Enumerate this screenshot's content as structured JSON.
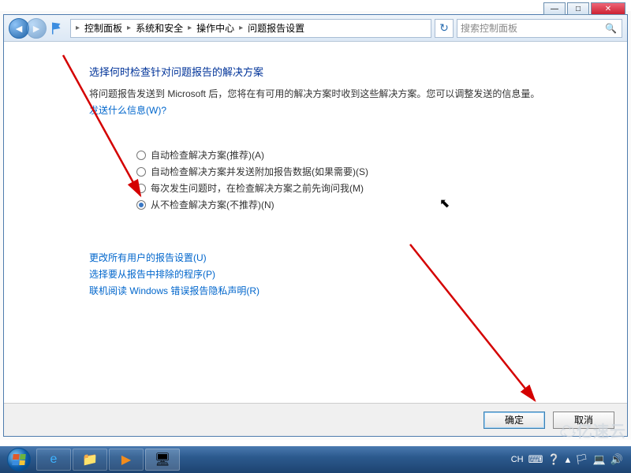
{
  "window_controls": {
    "min": "—",
    "max": "□",
    "close": "✕"
  },
  "breadcrumb": {
    "items": [
      "控制面板",
      "系统和安全",
      "操作中心",
      "问题报告设置"
    ]
  },
  "search": {
    "placeholder": "搜索控制面板"
  },
  "page": {
    "heading": "选择何时检查针对问题报告的解决方案",
    "description": "将问题报告发送到 Microsoft 后，您将在有可用的解决方案时收到这些解决方案。您可以调整发送的信息量。",
    "info_link": "发送什么信息(W)?"
  },
  "radios": {
    "r1": "自动检查解决方案(推荐)(A)",
    "r2": "自动检查解决方案并发送附加报告数据(如果需要)(S)",
    "r3": "每次发生问题时，在检查解决方案之前先询问我(M)",
    "r4": "从不检查解决方案(不推荐)(N)"
  },
  "links": {
    "l1": "更改所有用户的报告设置(U)",
    "l2": "选择要从报告中排除的程序(P)",
    "l3": "联机阅读 Windows 错误报告隐私声明(R)"
  },
  "buttons": {
    "ok": "确定",
    "cancel": "取消"
  },
  "tray": {
    "ime": "CH",
    "time": ""
  },
  "watermark": "亿速云"
}
